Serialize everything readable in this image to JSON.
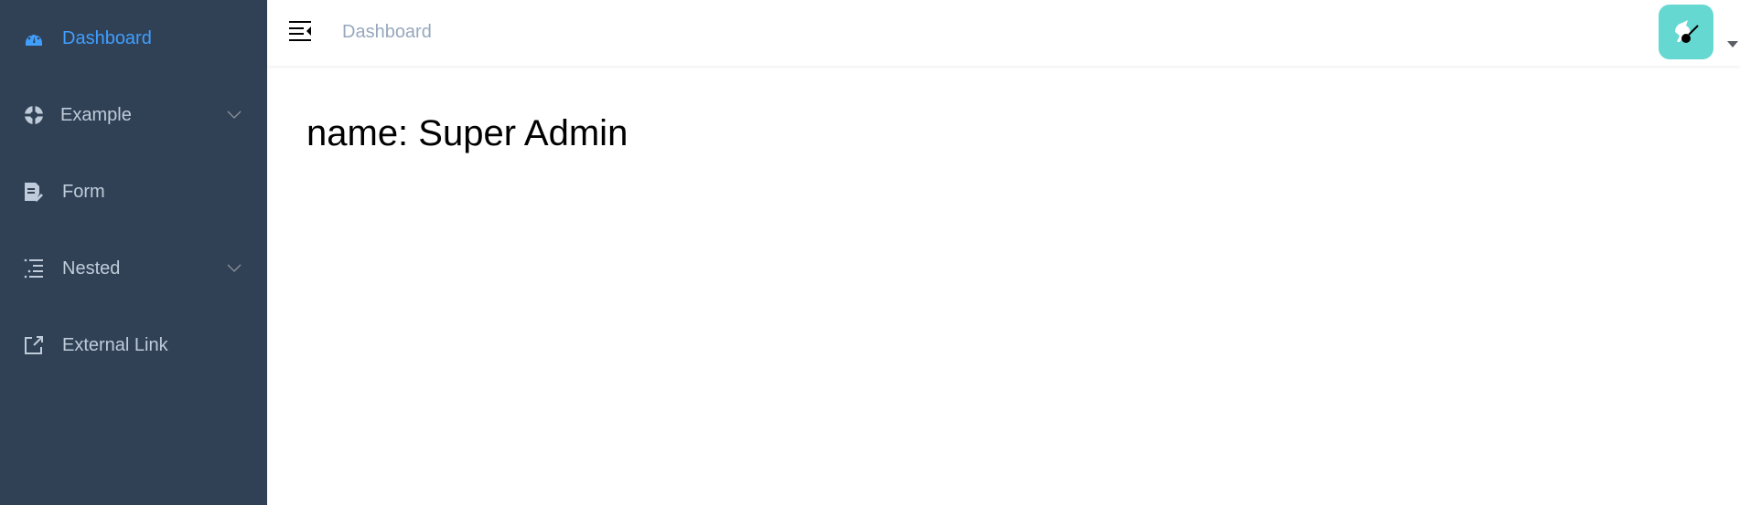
{
  "sidebar": {
    "items": [
      {
        "label": "Dashboard",
        "icon": "dashboard-icon",
        "active": true
      },
      {
        "label": "Example",
        "icon": "example-icon",
        "expandable": true
      },
      {
        "label": "Form",
        "icon": "form-icon"
      },
      {
        "label": "Nested",
        "icon": "nested-icon",
        "expandable": true
      },
      {
        "label": "External Link",
        "icon": "external-link-icon"
      }
    ]
  },
  "navbar": {
    "breadcrumb": "Dashboard",
    "toggle_icon": "hamburger-icon",
    "avatar_icon": "avatar-image",
    "dropdown_icon": "caret-down-icon"
  },
  "main": {
    "title": "name: Super Admin"
  },
  "colors": {
    "sidebar_bg": "#304156",
    "sidebar_text": "#bfcbd9",
    "active": "#409eff",
    "breadcrumb": "#97a8be",
    "avatar_bg": "#65d8d2"
  }
}
